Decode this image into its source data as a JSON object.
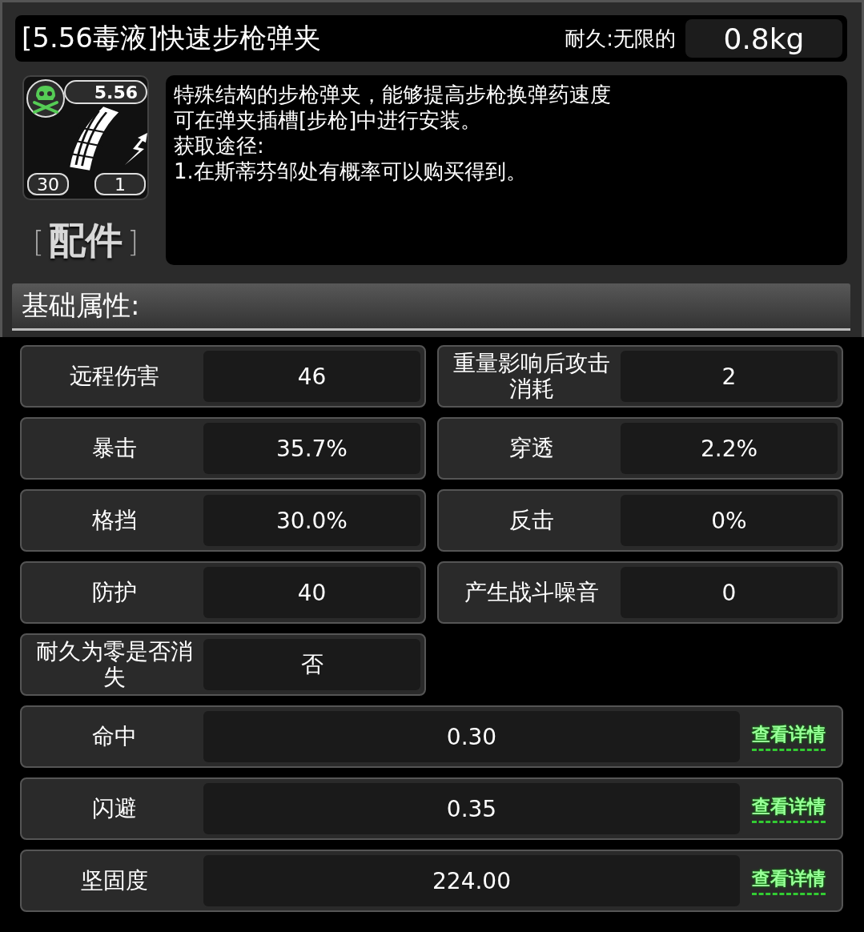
{
  "header": {
    "title": "[5.56毒液]快速步枪弹夹",
    "durability": "耐久:无限的",
    "weight": "0.8kg"
  },
  "item_icon": {
    "caliber": "5.56",
    "left_count": "30",
    "right_count": "1"
  },
  "category": {
    "bracket_left": "[",
    "label": "配件",
    "bracket_right": "]"
  },
  "description": [
    "特殊结构的步枪弹夹，能够提高步枪换弹药速度",
    "可在弹夹插槽[步枪]中进行安装。",
    "获取途径:",
    "1.在斯蒂芬邹处有概率可以购买得到。"
  ],
  "section_title": "基础属性:",
  "stats": [
    {
      "label": "远程伤害",
      "value": "46"
    },
    {
      "label": "重量影响后攻击消耗",
      "value": "2"
    },
    {
      "label": "暴击",
      "value": "35.7%"
    },
    {
      "label": "穿透",
      "value": "2.2%"
    },
    {
      "label": "格挡",
      "value": "30.0%"
    },
    {
      "label": "反击",
      "value": "0%"
    },
    {
      "label": "防护",
      "value": "40"
    },
    {
      "label": "产生战斗噪音",
      "value": "0"
    },
    {
      "label": "耐久为零是否消失",
      "value": "否"
    }
  ],
  "detail_stats": [
    {
      "label": "命中",
      "value": "0.30",
      "link": "查看详情"
    },
    {
      "label": "闪避",
      "value": "0.35",
      "link": "查看详情"
    },
    {
      "label": "坚固度",
      "value": "224.00",
      "link": "查看详情"
    }
  ]
}
